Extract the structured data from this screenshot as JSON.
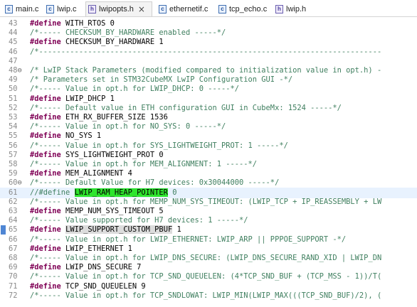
{
  "tabs": [
    {
      "label": "main.c",
      "icon": "c-file-icon",
      "glyph": "c",
      "active": false
    },
    {
      "label": "lwip.c",
      "icon": "c-file-icon",
      "glyph": "c",
      "active": false
    },
    {
      "label": "lwipopts.h",
      "icon": "h-file-icon",
      "glyph": "h",
      "active": true,
      "close": "×"
    },
    {
      "label": "ethernetif.c",
      "icon": "c-file-icon",
      "glyph": "c",
      "active": false
    },
    {
      "label": "tcp_echo.c",
      "icon": "c-file-icon",
      "glyph": "c",
      "active": false
    },
    {
      "label": "lwip.h",
      "icon": "h-file-icon",
      "glyph": "h",
      "active": false
    }
  ],
  "colors": {
    "keyword": "#7f0055",
    "comment": "#3f7f5f",
    "selection": "#2ee52e",
    "current_line": "#e8f2fe"
  },
  "lines": [
    {
      "n": "43",
      "segs": [
        {
          "t": "#define",
          "c": "kw"
        },
        {
          "t": " WITH_RTOS 0",
          "c": ""
        }
      ]
    },
    {
      "n": "44",
      "segs": [
        {
          "t": "/*----- CHECKSUM_BY_HARDWARE enabled -----*/",
          "c": "cm"
        }
      ]
    },
    {
      "n": "45",
      "segs": [
        {
          "t": "#define",
          "c": "kw"
        },
        {
          "t": " CHECKSUM_BY_HARDWARE 1",
          "c": ""
        }
      ]
    },
    {
      "n": "46",
      "segs": [
        {
          "t": "/*-----------------------------------------------------------------------------",
          "c": "cm"
        }
      ]
    },
    {
      "n": "47",
      "segs": []
    },
    {
      "n": "48",
      "fold": "⊖",
      "segs": [
        {
          "t": "/* LwIP Stack Parameters (modified compared to initialization value in opt.h) -",
          "c": "cm"
        }
      ]
    },
    {
      "n": "49",
      "segs": [
        {
          "t": "/* Parameters set in STM32CubeMX LwIP Configuration GUI -*/",
          "c": "cm"
        }
      ]
    },
    {
      "n": "50",
      "segs": [
        {
          "t": "/*----- Value in opt.h for LWIP_DHCP: 0 -----*/",
          "c": "cm"
        }
      ]
    },
    {
      "n": "51",
      "segs": [
        {
          "t": "#define",
          "c": "kw"
        },
        {
          "t": " LWIP_DHCP 1",
          "c": ""
        }
      ]
    },
    {
      "n": "52",
      "segs": [
        {
          "t": "/*----- Default value in ETH configuration GUI in CubeMx: 1524 -----*/",
          "c": "cm"
        }
      ]
    },
    {
      "n": "53",
      "segs": [
        {
          "t": "#define",
          "c": "kw"
        },
        {
          "t": " ETH_RX_BUFFER_SIZE 1536",
          "c": ""
        }
      ]
    },
    {
      "n": "54",
      "segs": [
        {
          "t": "/*----- Value in opt.h for NO_SYS: 0 -----*/",
          "c": "cm"
        }
      ]
    },
    {
      "n": "55",
      "segs": [
        {
          "t": "#define",
          "c": "kw"
        },
        {
          "t": " NO_SYS 1",
          "c": ""
        }
      ]
    },
    {
      "n": "56",
      "segs": [
        {
          "t": "/*----- Value in opt.h for SYS_LIGHTWEIGHT_PROT: 1 -----*/",
          "c": "cm"
        }
      ]
    },
    {
      "n": "57",
      "segs": [
        {
          "t": "#define",
          "c": "kw"
        },
        {
          "t": " SYS_LIGHTWEIGHT_PROT 0",
          "c": ""
        }
      ]
    },
    {
      "n": "58",
      "segs": [
        {
          "t": "/*----- Value in opt.h for MEM_ALIGNMENT: 1 -----*/",
          "c": "cm"
        }
      ]
    },
    {
      "n": "59",
      "segs": [
        {
          "t": "#define",
          "c": "kw"
        },
        {
          "t": " MEM_ALIGNMENT 4",
          "c": ""
        }
      ]
    },
    {
      "n": "60",
      "fold": "⊖",
      "segs": [
        {
          "t": "/*----- Default Value for H7 devices: 0x30044000 -----*/",
          "c": "cm"
        }
      ]
    },
    {
      "n": "61",
      "current": true,
      "segs": [
        {
          "t": "//#define ",
          "c": "cm"
        },
        {
          "t": "LWIP_RAM_HEAP_POINTER",
          "c": "sel"
        },
        {
          "t": " 0",
          "c": "cm"
        }
      ]
    },
    {
      "n": "62",
      "segs": [
        {
          "t": "/*----- Value in opt.h for MEMP_NUM_SYS_TIMEOUT: (LWIP_TCP + IP_REASSEMBLY + LW",
          "c": "cm"
        }
      ]
    },
    {
      "n": "63",
      "segs": [
        {
          "t": "#define",
          "c": "kw"
        },
        {
          "t": " MEMP_NUM_SYS_TIMEOUT 5",
          "c": ""
        }
      ]
    },
    {
      "n": "64",
      "segs": [
        {
          "t": "/*----- Value supported for H7 devices: 1 -----*/",
          "c": "cm"
        }
      ]
    },
    {
      "n": "65",
      "bookmark": true,
      "segs": [
        {
          "t": "#define",
          "c": "kw"
        },
        {
          "t": " ",
          "c": ""
        },
        {
          "t": "LWIP_SUPPORT_CUSTOM_PBUF",
          "c": "marker"
        },
        {
          "t": " 1",
          "c": ""
        }
      ]
    },
    {
      "n": "66",
      "segs": [
        {
          "t": "/*----- Value in opt.h for LWIP_ETHERNET: LWIP_ARP || PPPOE_SUPPORT -*/",
          "c": "cm"
        }
      ]
    },
    {
      "n": "67",
      "segs": [
        {
          "t": "#define",
          "c": "kw"
        },
        {
          "t": " LWIP_ETHERNET 1",
          "c": ""
        }
      ]
    },
    {
      "n": "68",
      "segs": [
        {
          "t": "/*----- Value in opt.h for LWIP_DNS_SECURE: (LWIP_DNS_SECURE_RAND_XID | LWIP_DN",
          "c": "cm"
        }
      ]
    },
    {
      "n": "69",
      "segs": [
        {
          "t": "#define",
          "c": "kw"
        },
        {
          "t": " LWIP_DNS_SECURE 7",
          "c": ""
        }
      ]
    },
    {
      "n": "70",
      "segs": [
        {
          "t": "/*----- Value in opt.h for TCP_SND_QUEUELEN: (4*TCP_SND_BUF + (TCP_MSS - 1))/T(",
          "c": "cm"
        }
      ]
    },
    {
      "n": "71",
      "segs": [
        {
          "t": "#define",
          "c": "kw"
        },
        {
          "t": " TCP_SND_QUEUELEN 9",
          "c": ""
        }
      ]
    },
    {
      "n": "72",
      "segs": [
        {
          "t": "/*----- Value in opt.h for TCP_SNDLOWAT: LWIP_MIN(LWIP_MAX(((TCP_SND_BUF)/2), (",
          "c": "cm"
        }
      ]
    }
  ]
}
